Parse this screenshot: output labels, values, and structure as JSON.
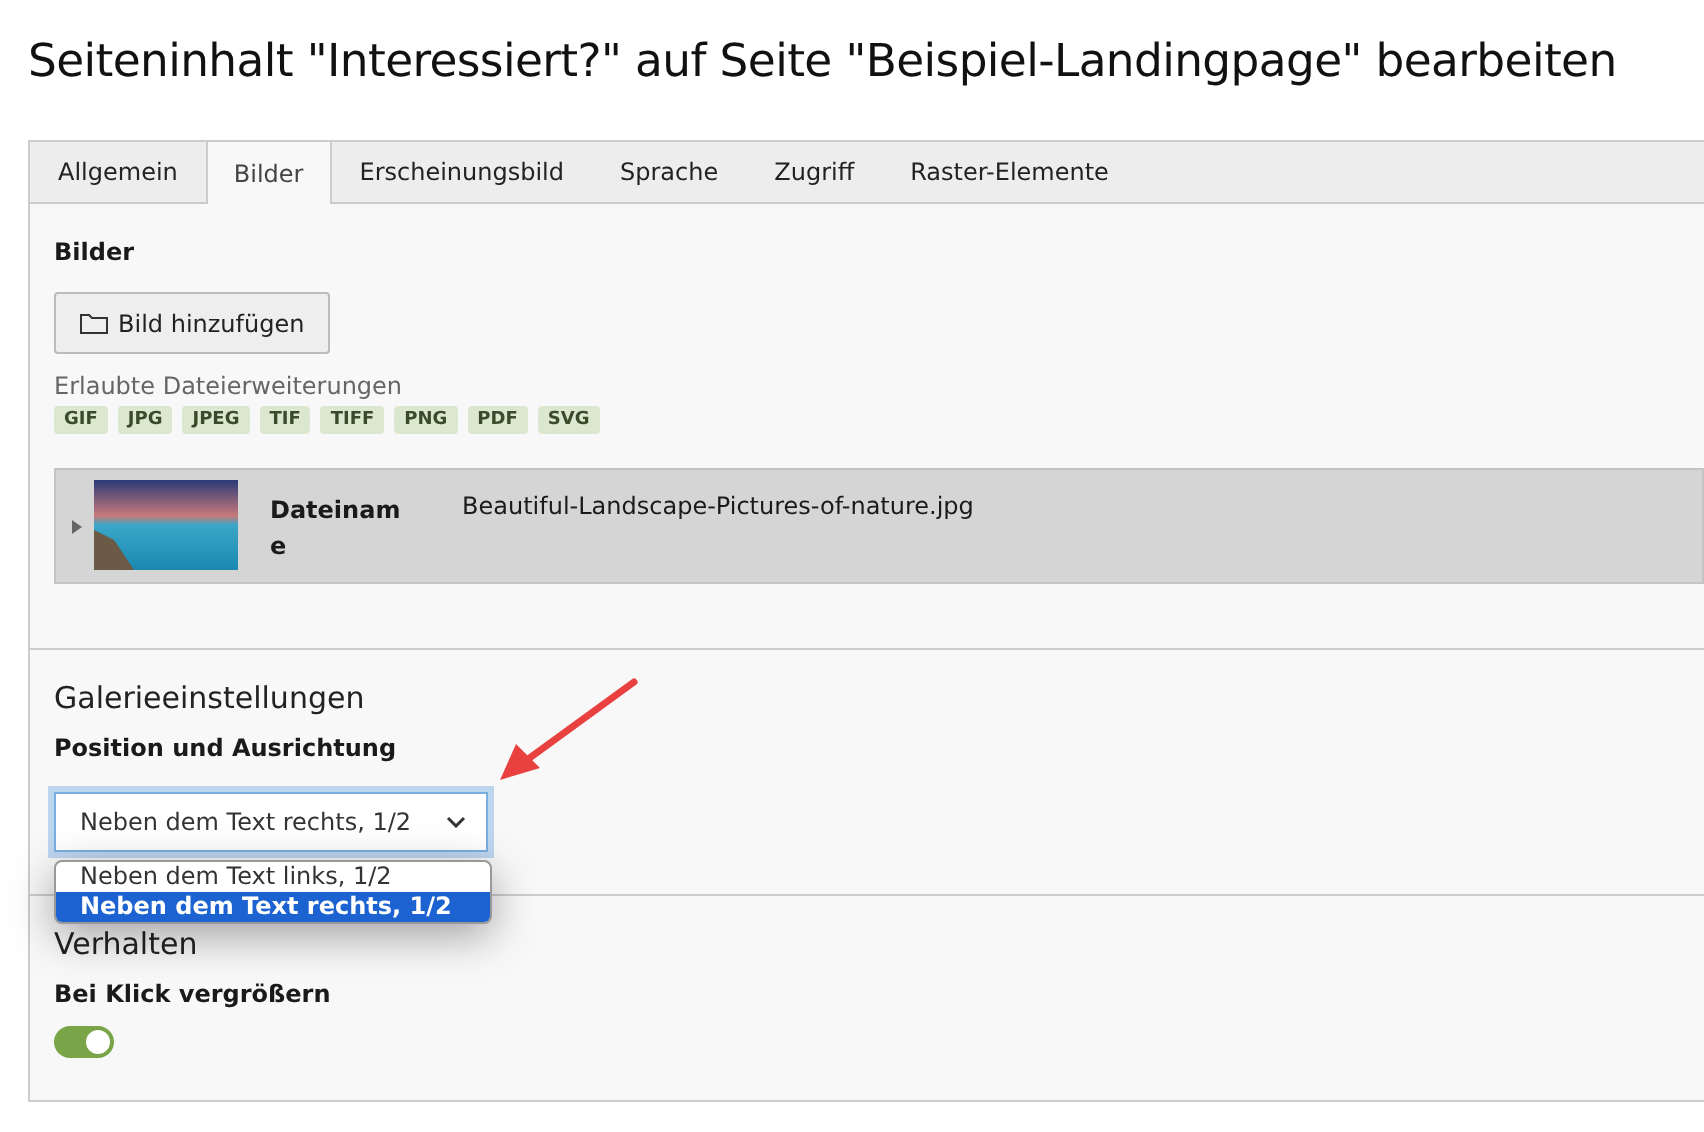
{
  "title": "Seiteninhalt \"Interessiert?\" auf Seite \"Beispiel-Landingpage\" bearbeiten",
  "tabs": [
    {
      "label": "Allgemein",
      "selected": false
    },
    {
      "label": "Bilder",
      "selected": true
    },
    {
      "label": "Erscheinungsbild",
      "selected": false
    },
    {
      "label": "Sprache",
      "selected": false
    },
    {
      "label": "Zugriff",
      "selected": false
    },
    {
      "label": "Raster-Elemente",
      "selected": false
    }
  ],
  "images": {
    "heading": "Bilder",
    "add_button": "Bild hinzufügen",
    "extensions_label": "Erlaubte Dateierweiterungen",
    "extensions": [
      "GIF",
      "JPG",
      "JPEG",
      "TIF",
      "TIFF",
      "PNG",
      "PDF",
      "SVG"
    ],
    "file": {
      "expanded": false,
      "field_label": "Dateiname",
      "value": "Beautiful-Landscape-Pictures-of-nature.jpg"
    }
  },
  "gallery": {
    "heading": "Galerieeinstellungen",
    "field_label": "Position und Ausrichtung",
    "select_value": "Neben dem Text rechts, 1/2",
    "open": true,
    "options": [
      {
        "label": "Neben dem Text links, 1/2",
        "selected": false
      },
      {
        "label": "Neben dem Text rechts, 1/2",
        "selected": true
      }
    ]
  },
  "behavior": {
    "heading": "Verhalten",
    "toggle_label": "Bei Klick vergrößern",
    "on": true
  }
}
